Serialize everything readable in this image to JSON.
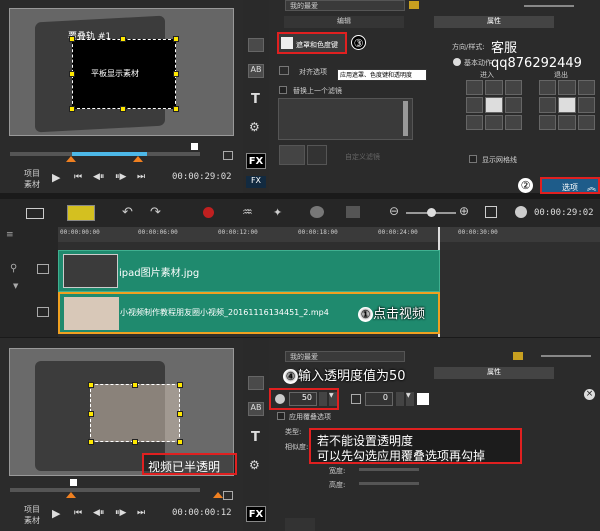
{
  "top_preview": {
    "track_overlay_label": "覆叠轨 #1",
    "overlay_text": "平板显示素材",
    "project_label": "项目",
    "clip_label": "素材",
    "timecode": "00:00:29:02"
  },
  "top_options": {
    "dropdown": "我的最爱",
    "tab_edit": "编辑",
    "tab_props": "属性",
    "mask_button": "遮罩和色度键",
    "tooltip": "应用遮罩、色度键和透明度",
    "align_label": "对齐选项",
    "replace_label": "替换上一个滤镜",
    "direction_label": "方向/样式:",
    "basic_motion": "基本动作",
    "enter_label": "进入",
    "exit_label": "退出",
    "show_grid": "显示网格线",
    "options_button": "选项",
    "watermark": "客服qq876292449",
    "custom_filter": "自定义滤镜"
  },
  "toolbar": {
    "timecode": "00:00:29:02"
  },
  "timeline": {
    "ruler": [
      "00:00:00:00",
      "00:00:06:00",
      "00:00:12:00",
      "00:00:18:00",
      "00:00:24:00",
      "00:00:30:00"
    ],
    "clip1": "ipad图片素材.jpg",
    "clip2": "小视频制作教程朋友圈小视频_20161116134451_2.mp4"
  },
  "bottom_preview": {
    "project_label": "项目",
    "clip_label": "素材",
    "timecode": "00:00:00:12"
  },
  "bottom_options": {
    "dropdown": "我的最爱",
    "tab_props": "属性",
    "opacity_value": "50",
    "field2_value": "0",
    "apply_overlay": "应用覆叠选项",
    "type_label": "类型:",
    "similar_label": "相似度:",
    "width_label": "宽度:",
    "height_label": "高度:"
  },
  "annotations": {
    "n1": "①",
    "a1": "点击视频",
    "n2": "②",
    "n3": "③",
    "n4": "④",
    "a4": "输入透明度值为50",
    "a5_line1": "若不能设置透明度",
    "a5_line2": "可以先勾选应用覆叠选项再勾掉",
    "a6": "视频已半透明"
  },
  "colors": {
    "clip_green": "#1f8a6e",
    "highlight_red": "#e02020",
    "handle_yellow": "#ffe800",
    "options_blue": "#1e5c8a"
  }
}
